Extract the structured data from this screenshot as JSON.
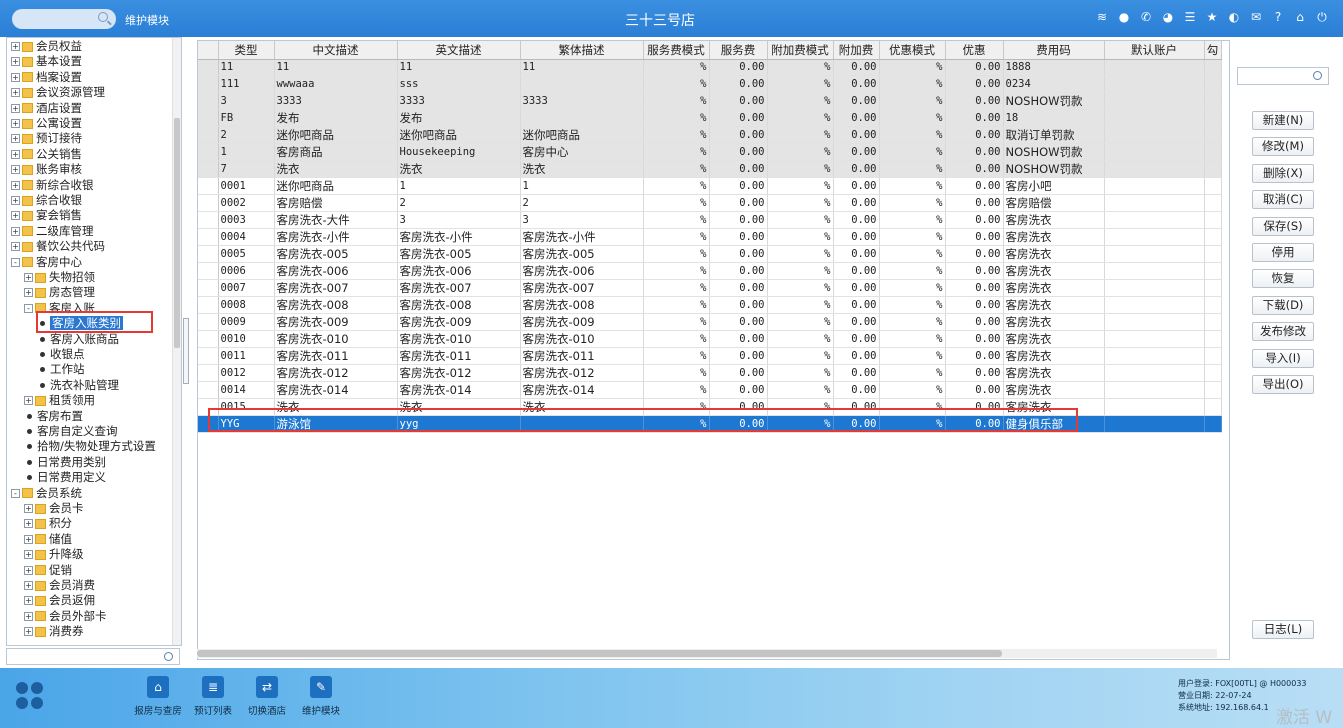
{
  "topbar": {
    "module": "维护模块",
    "store": "三十三号店",
    "icons": [
      "wifi-icon",
      "message-icon",
      "phone-icon",
      "palette-icon",
      "menu-icon",
      "star-icon",
      "theme-icon",
      "mail-icon",
      "help-icon",
      "home-icon",
      "power-icon"
    ]
  },
  "tree": {
    "items": [
      {
        "label": "会员权益",
        "level": 0,
        "type": "folder",
        "expander": "+"
      },
      {
        "label": "基本设置",
        "level": 0,
        "type": "folder",
        "expander": "+"
      },
      {
        "label": "档案设置",
        "level": 0,
        "type": "folder",
        "expander": "+"
      },
      {
        "label": "会议资源管理",
        "level": 0,
        "type": "folder",
        "expander": "+"
      },
      {
        "label": "酒店设置",
        "level": 0,
        "type": "folder",
        "expander": "+"
      },
      {
        "label": "公寓设置",
        "level": 0,
        "type": "folder",
        "expander": "+"
      },
      {
        "label": "预订接待",
        "level": 0,
        "type": "folder",
        "expander": "+"
      },
      {
        "label": "公关销售",
        "level": 0,
        "type": "folder",
        "expander": "+"
      },
      {
        "label": "账务审核",
        "level": 0,
        "type": "folder",
        "expander": "+"
      },
      {
        "label": "新综合收银",
        "level": 0,
        "type": "folder",
        "expander": "+"
      },
      {
        "label": "综合收银",
        "level": 0,
        "type": "folder",
        "expander": "+"
      },
      {
        "label": "宴会销售",
        "level": 0,
        "type": "folder",
        "expander": "+"
      },
      {
        "label": "二级库管理",
        "level": 0,
        "type": "folder",
        "expander": "+"
      },
      {
        "label": "餐饮公共代码",
        "level": 0,
        "type": "folder",
        "expander": "+"
      },
      {
        "label": "客房中心",
        "level": 0,
        "type": "folder",
        "expander": "-"
      },
      {
        "label": "失物招领",
        "level": 1,
        "type": "folder",
        "expander": "+"
      },
      {
        "label": "房态管理",
        "level": 1,
        "type": "folder",
        "expander": "+"
      },
      {
        "label": "客房入账",
        "level": 1,
        "type": "folder",
        "expander": "-"
      },
      {
        "label": "客房入账类别",
        "level": 2,
        "type": "leaf",
        "selected": true
      },
      {
        "label": "客房入账商品",
        "level": 2,
        "type": "leaf"
      },
      {
        "label": "收银点",
        "level": 2,
        "type": "leaf"
      },
      {
        "label": "工作站",
        "level": 2,
        "type": "leaf"
      },
      {
        "label": "洗衣补贴管理",
        "level": 2,
        "type": "leaf"
      },
      {
        "label": "租赁领用",
        "level": 1,
        "type": "folder",
        "expander": "+"
      },
      {
        "label": "客房布置",
        "level": 1,
        "type": "leaf"
      },
      {
        "label": "客房自定义查询",
        "level": 1,
        "type": "leaf"
      },
      {
        "label": "拾物/失物处理方式设置",
        "level": 1,
        "type": "leaf"
      },
      {
        "label": "日常费用类别",
        "level": 1,
        "type": "leaf"
      },
      {
        "label": "日常费用定义",
        "level": 1,
        "type": "leaf"
      },
      {
        "label": "会员系统",
        "level": 0,
        "type": "folder",
        "expander": "-"
      },
      {
        "label": "会员卡",
        "level": 1,
        "type": "folder",
        "expander": "+"
      },
      {
        "label": "积分",
        "level": 1,
        "type": "folder",
        "expander": "+"
      },
      {
        "label": "储值",
        "level": 1,
        "type": "folder",
        "expander": "+"
      },
      {
        "label": "升降级",
        "level": 1,
        "type": "folder",
        "expander": "+"
      },
      {
        "label": "促销",
        "level": 1,
        "type": "folder",
        "expander": "+"
      },
      {
        "label": "会员消费",
        "level": 1,
        "type": "folder",
        "expander": "+"
      },
      {
        "label": "会员返佣",
        "level": 1,
        "type": "folder",
        "expander": "+"
      },
      {
        "label": "会员外部卡",
        "level": 1,
        "type": "folder",
        "expander": "+"
      },
      {
        "label": "消费券",
        "level": 1,
        "type": "folder",
        "expander": "+"
      }
    ]
  },
  "grid": {
    "columns": [
      "类型",
      "中文描述",
      "英文描述",
      "繁体描述",
      "服务费模式",
      "服务费",
      "附加费模式",
      "附加费",
      "优惠模式",
      "优惠",
      "费用码",
      "默认账户",
      "勾"
    ],
    "rows": [
      {
        "style": "gray",
        "cells": [
          "11",
          "11",
          "11",
          "11",
          "%",
          "0.00",
          "%",
          "0.00",
          "%",
          "0.00",
          "1888",
          "",
          ""
        ]
      },
      {
        "style": "gray",
        "cells": [
          "111",
          "wwwaaa",
          "sss",
          "",
          "%",
          "0.00",
          "%",
          "0.00",
          "%",
          "0.00",
          "0234",
          "",
          ""
        ]
      },
      {
        "style": "gray",
        "cells": [
          "3",
          "3333",
          "3333",
          "3333",
          "%",
          "0.00",
          "%",
          "0.00",
          "%",
          "0.00",
          "NOSHOW罚款",
          "",
          ""
        ]
      },
      {
        "style": "gray",
        "cells": [
          "FB",
          "发布",
          "发布",
          "",
          "%",
          "0.00",
          "%",
          "0.00",
          "%",
          "0.00",
          "18",
          "",
          ""
        ]
      },
      {
        "style": "gray",
        "cells": [
          "2",
          "迷你吧商品",
          "迷你吧商品",
          "迷你吧商品",
          "%",
          "0.00",
          "%",
          "0.00",
          "%",
          "0.00",
          "取消订单罚款",
          "",
          ""
        ]
      },
      {
        "style": "gray",
        "cells": [
          "1",
          "客房商品",
          "Housekeeping",
          "客房中心",
          "%",
          "0.00",
          "%",
          "0.00",
          "%",
          "0.00",
          "NOSHOW罚款",
          "",
          ""
        ]
      },
      {
        "style": "gray",
        "cells": [
          "7",
          "洗衣",
          "洗衣",
          "洗衣",
          "%",
          "0.00",
          "%",
          "0.00",
          "%",
          "0.00",
          "NOSHOW罚款",
          "",
          ""
        ]
      },
      {
        "style": "white",
        "cells": [
          "0001",
          "迷你吧商品",
          "1",
          "1",
          "%",
          "0.00",
          "%",
          "0.00",
          "%",
          "0.00",
          "客房小吧",
          "",
          ""
        ]
      },
      {
        "style": "white",
        "cells": [
          "0002",
          "客房赔偿",
          "2",
          "2",
          "%",
          "0.00",
          "%",
          "0.00",
          "%",
          "0.00",
          "客房赔偿",
          "",
          ""
        ]
      },
      {
        "style": "white",
        "cells": [
          "0003",
          "客房洗衣-大件",
          "3",
          "3",
          "%",
          "0.00",
          "%",
          "0.00",
          "%",
          "0.00",
          "客房洗衣",
          "",
          ""
        ]
      },
      {
        "style": "white",
        "cells": [
          "0004",
          "客房洗衣-小件",
          "客房洗衣-小件",
          "客房洗衣-小件",
          "%",
          "0.00",
          "%",
          "0.00",
          "%",
          "0.00",
          "客房洗衣",
          "",
          ""
        ]
      },
      {
        "style": "white",
        "cells": [
          "0005",
          "客房洗衣-005",
          "客房洗衣-005",
          "客房洗衣-005",
          "%",
          "0.00",
          "%",
          "0.00",
          "%",
          "0.00",
          "客房洗衣",
          "",
          ""
        ]
      },
      {
        "style": "white",
        "cells": [
          "0006",
          "客房洗衣-006",
          "客房洗衣-006",
          "客房洗衣-006",
          "%",
          "0.00",
          "%",
          "0.00",
          "%",
          "0.00",
          "客房洗衣",
          "",
          ""
        ]
      },
      {
        "style": "white",
        "cells": [
          "0007",
          "客房洗衣-007",
          "客房洗衣-007",
          "客房洗衣-007",
          "%",
          "0.00",
          "%",
          "0.00",
          "%",
          "0.00",
          "客房洗衣",
          "",
          ""
        ]
      },
      {
        "style": "white",
        "cells": [
          "0008",
          "客房洗衣-008",
          "客房洗衣-008",
          "客房洗衣-008",
          "%",
          "0.00",
          "%",
          "0.00",
          "%",
          "0.00",
          "客房洗衣",
          "",
          ""
        ]
      },
      {
        "style": "white",
        "cells": [
          "0009",
          "客房洗衣-009",
          "客房洗衣-009",
          "客房洗衣-009",
          "%",
          "0.00",
          "%",
          "0.00",
          "%",
          "0.00",
          "客房洗衣",
          "",
          ""
        ]
      },
      {
        "style": "white",
        "cells": [
          "0010",
          "客房洗衣-010",
          "客房洗衣-010",
          "客房洗衣-010",
          "%",
          "0.00",
          "%",
          "0.00",
          "%",
          "0.00",
          "客房洗衣",
          "",
          ""
        ]
      },
      {
        "style": "white",
        "cells": [
          "0011",
          "客房洗衣-011",
          "客房洗衣-011",
          "客房洗衣-011",
          "%",
          "0.00",
          "%",
          "0.00",
          "%",
          "0.00",
          "客房洗衣",
          "",
          ""
        ]
      },
      {
        "style": "white",
        "cells": [
          "0012",
          "客房洗衣-012",
          "客房洗衣-012",
          "客房洗衣-012",
          "%",
          "0.00",
          "%",
          "0.00",
          "%",
          "0.00",
          "客房洗衣",
          "",
          ""
        ]
      },
      {
        "style": "white",
        "cells": [
          "0014",
          "客房洗衣-014",
          "客房洗衣-014",
          "客房洗衣-014",
          "%",
          "0.00",
          "%",
          "0.00",
          "%",
          "0.00",
          "客房洗衣",
          "",
          ""
        ]
      },
      {
        "style": "white",
        "cells": [
          "0015",
          "洗衣",
          "洗衣",
          "洗衣",
          "%",
          "0.00",
          "%",
          "0.00",
          "%",
          "0.00",
          "客房洗衣",
          "",
          ""
        ]
      },
      {
        "style": "sel",
        "cells": [
          "YYG",
          "游泳馆",
          "yyg",
          "",
          "%",
          "0.00",
          "%",
          "0.00",
          "%",
          "0.00",
          "健身俱乐部",
          "",
          ""
        ]
      }
    ]
  },
  "actions": [
    {
      "name": "new-button",
      "label": "新建(N)"
    },
    {
      "name": "edit-button",
      "label": "修改(M)"
    },
    {
      "name": "delete-button",
      "label": "删除(X)"
    },
    {
      "name": "cancel-button",
      "label": "取消(C)"
    },
    {
      "name": "save-button",
      "label": "保存(S)"
    },
    {
      "name": "disable-button",
      "label": "停用"
    },
    {
      "name": "restore-button",
      "label": "恢复"
    },
    {
      "name": "download-button",
      "label": "下载(D)"
    },
    {
      "name": "publish-edit-button",
      "label": "发布修改"
    },
    {
      "name": "import-button",
      "label": "导入(I)"
    },
    {
      "name": "export-button",
      "label": "导出(O)"
    }
  ],
  "log_button": "日志(L)",
  "bottom": {
    "modules": [
      {
        "name": "room-status-module",
        "label": "报房与查房",
        "icon": "⌂"
      },
      {
        "name": "reservation-list-module",
        "label": "预订列表",
        "icon": "≣"
      },
      {
        "name": "switch-hotel-module",
        "label": "切换酒店",
        "icon": "⇄"
      },
      {
        "name": "maintenance-module",
        "label": "维护模块",
        "icon": "✎"
      }
    ],
    "user_line": "用户登录:   FOX[00TL] @ H000033",
    "date_line": "营业日期:   22-07-24",
    "ip_line": "系统地址:   192.168.64.1"
  },
  "watermark": "激活 W"
}
